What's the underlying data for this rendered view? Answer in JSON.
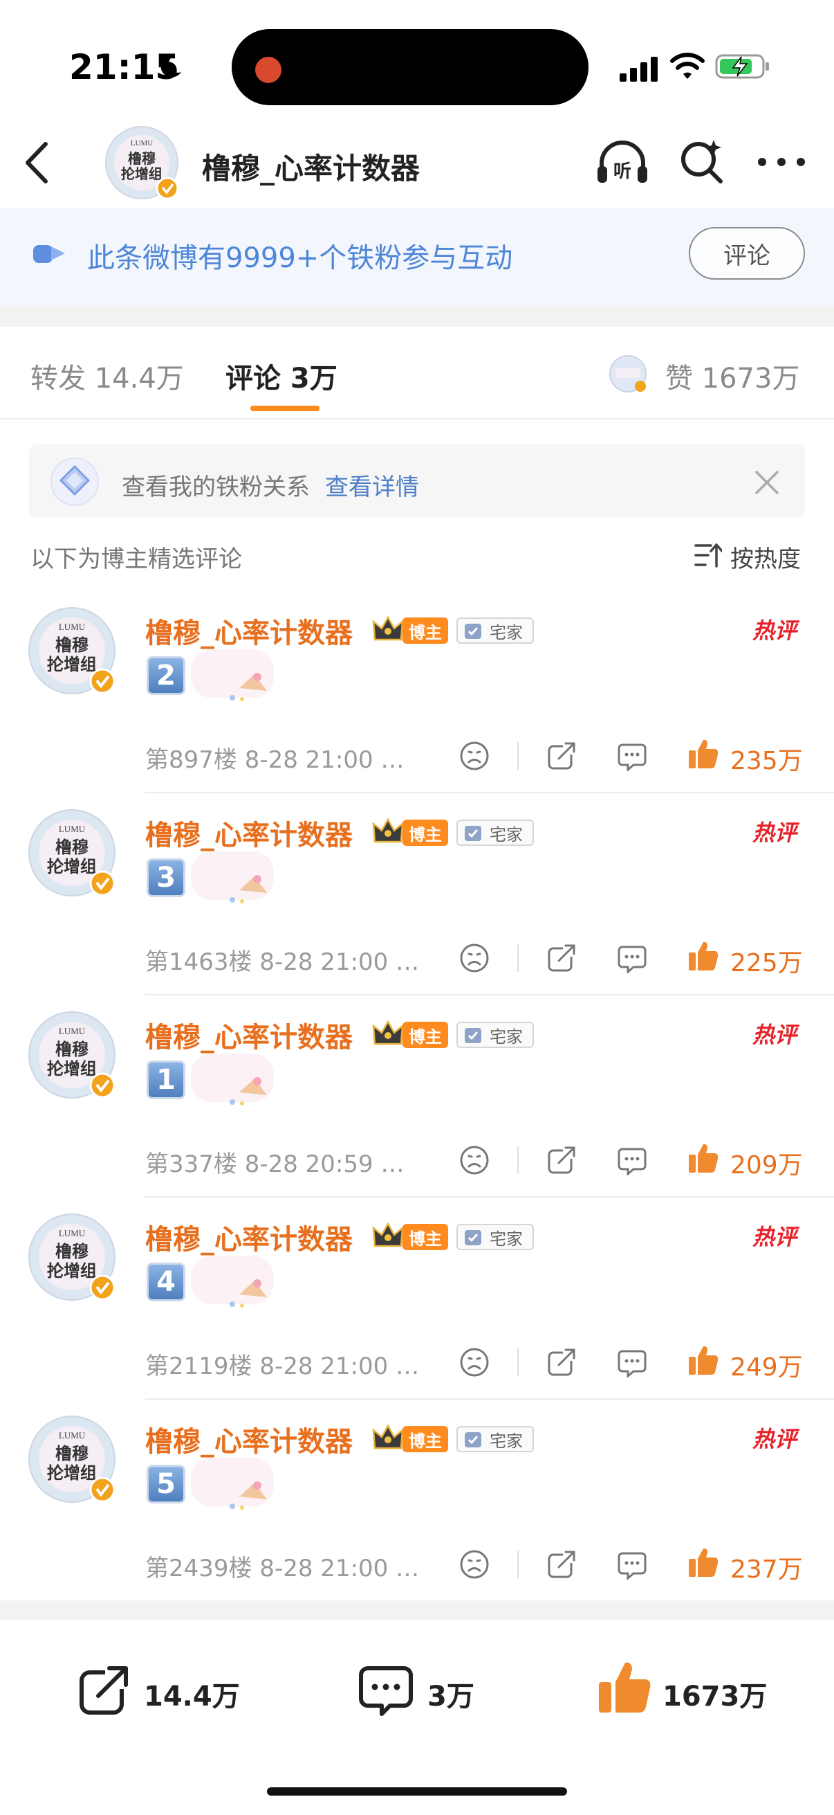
{
  "status_bar": {
    "time": "21:15"
  },
  "header": {
    "title": "橹穆_心率计数器",
    "listen_label": "听"
  },
  "banner": {
    "text": "此条微博有9999+个铁粉参与互动",
    "button": "评论"
  },
  "tabs": {
    "repost": "转发 14.4万",
    "comment": "评论 3万",
    "like": "赞 1673万"
  },
  "fan_box": {
    "text": "查看我的铁粉关系",
    "link": "查看详情"
  },
  "selection": {
    "label": "以下为博主精选评论",
    "sort": "按热度"
  },
  "avatar_text": {
    "top": "LUMU",
    "line1": "橹穆",
    "line2": "抡增组"
  },
  "badges": {
    "bozhu": "博主",
    "zhai": "宅家",
    "hot": "热评"
  },
  "comments": [
    {
      "name": "橹穆_心率计数器",
      "number": "2",
      "meta": "第897楼  8-28 21:00  …",
      "likes": "235万"
    },
    {
      "name": "橹穆_心率计数器",
      "number": "3",
      "meta": "第1463楼  8-28 21:00  …",
      "likes": "225万"
    },
    {
      "name": "橹穆_心率计数器",
      "number": "1",
      "meta": "第337楼  8-28 20:59  …",
      "likes": "209万"
    },
    {
      "name": "橹穆_心率计数器",
      "number": "4",
      "meta": "第2119楼  8-28 21:00  …",
      "likes": "249万"
    },
    {
      "name": "橹穆_心率计数器",
      "number": "5",
      "meta": "第2439楼  8-28 21:00  …",
      "likes": "237万"
    }
  ],
  "bottom_bar": {
    "share": "14.4万",
    "comment": "3万",
    "like": "1673万"
  },
  "colors": {
    "accent": "#e76f1e",
    "link": "#4e86d8",
    "hot": "#e6232b"
  }
}
